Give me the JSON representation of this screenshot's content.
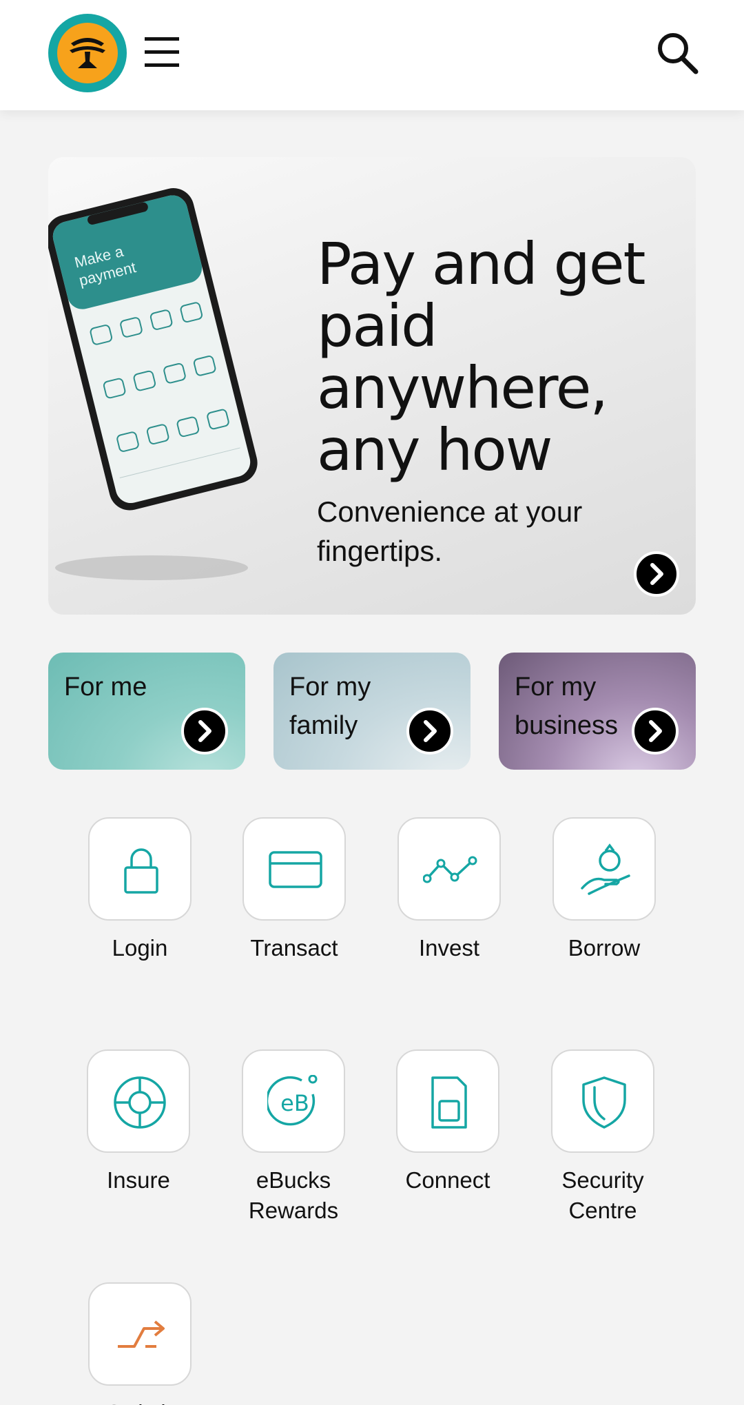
{
  "header": {
    "logo": "fnb-tree-logo",
    "menu_icon": "hamburger-menu-icon",
    "search_icon": "search-icon"
  },
  "hero": {
    "phone_screen_title": "Make a payment",
    "title": "Pay and get paid anywhere, any how",
    "subtitle": "Convenience at your fingertips."
  },
  "segments": [
    {
      "label": "For me"
    },
    {
      "label": "For my family"
    },
    {
      "label": "For my business"
    }
  ],
  "tiles": [
    {
      "label": "Login",
      "icon": "lock-icon"
    },
    {
      "label": "Transact",
      "icon": "card-icon"
    },
    {
      "label": "Invest",
      "icon": "chart-line-icon"
    },
    {
      "label": "Borrow",
      "icon": "hand-money-bag-icon"
    },
    {
      "label": "Insure",
      "icon": "lifebuoy-icon"
    },
    {
      "label": "eBucks Rewards",
      "icon": "ebucks-icon"
    },
    {
      "label": "Connect",
      "icon": "sim-card-icon"
    },
    {
      "label": "Security Centre",
      "icon": "shield-icon"
    },
    {
      "label": "Switch",
      "icon": "switch-arrows-icon"
    }
  ],
  "colors": {
    "brand_teal": "#15a6a4",
    "brand_orange": "#f7a21b",
    "switch_orange": "#e27d3f"
  }
}
